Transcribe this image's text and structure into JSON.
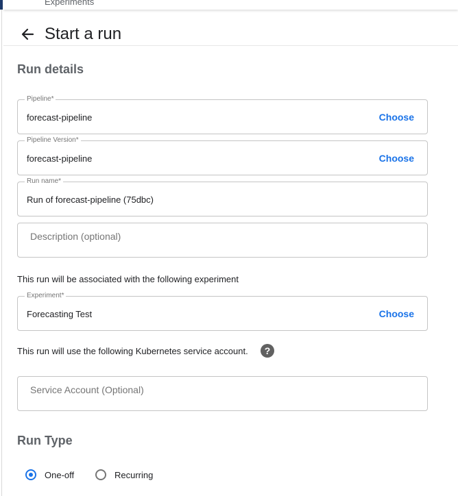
{
  "header": {
    "breadcrumb": "Experiments",
    "title": "Start a run"
  },
  "run_details": {
    "section_title": "Run details",
    "pipeline": {
      "label": "Pipeline*",
      "value": "forecast-pipeline",
      "action": "Choose"
    },
    "pipeline_version": {
      "label": "Pipeline Version*",
      "value": "forecast-pipeline",
      "action": "Choose"
    },
    "run_name": {
      "label": "Run name*",
      "value": "Run of forecast-pipeline (75dbc)"
    },
    "description": {
      "placeholder": "Description (optional)"
    },
    "experiment_note": "This run will be associated with the following experiment",
    "experiment": {
      "label": "Experiment*",
      "value": "Forecasting Test",
      "action": "Choose"
    },
    "service_account_note": "This run will use the following Kubernetes service account.",
    "help_glyph": "?",
    "service_account": {
      "placeholder": "Service Account (Optional)"
    }
  },
  "run_type": {
    "section_title": "Run Type",
    "options": [
      {
        "label": "One-off",
        "selected": true
      },
      {
        "label": "Recurring",
        "selected": false
      }
    ]
  },
  "colors": {
    "accent": "#1a73e8",
    "border": "#c4c4c4",
    "nav_strip": "#1d3a6b"
  },
  "icons": {
    "back": "arrow-left-icon",
    "help": "help-circle-icon"
  }
}
